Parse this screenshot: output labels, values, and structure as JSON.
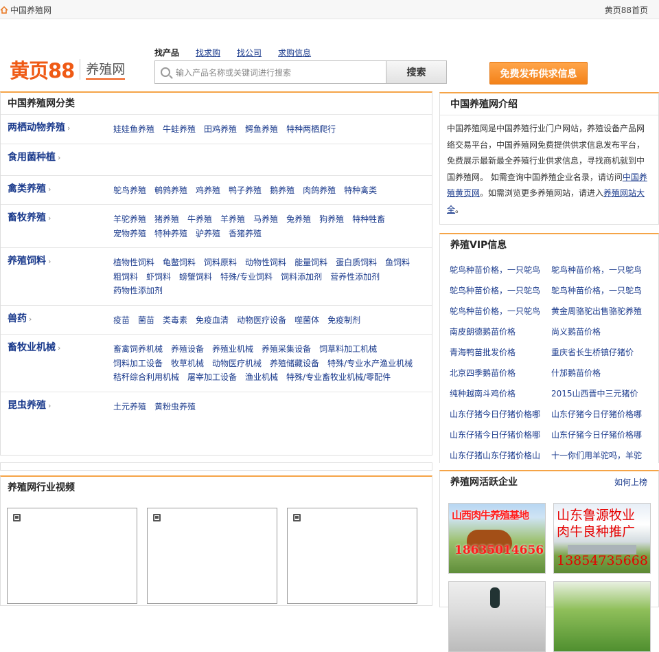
{
  "topbar": {
    "home_label": "中国养殖网",
    "right_link": "黄页88首页"
  },
  "logo": {
    "brand": "黄页88",
    "subbrand": "养殖网"
  },
  "search": {
    "tabs": [
      "找产品",
      "找求购",
      "找公司",
      "求购信息"
    ],
    "placeholder": "输入产品名称或关键词进行搜索",
    "button": "搜索"
  },
  "publish_button": "免费发布供求信息",
  "categories_panel": {
    "title": "中国养殖网分类",
    "categories": [
      {
        "name": "两栖动物养殖",
        "items": [
          "娃娃鱼养殖",
          "牛蛙养殖",
          "田鸡养殖",
          "鳄鱼养殖",
          "特种两栖爬行"
        ]
      },
      {
        "name": "食用菌种植",
        "items": []
      },
      {
        "name": "禽类养殖",
        "items": [
          "鸵鸟养殖",
          "鹌鹑养殖",
          "鸡养殖",
          "鸭子养殖",
          "鹅养殖",
          "肉鸽养殖",
          "特种禽类"
        ]
      },
      {
        "name": "畜牧养殖",
        "items": [
          "羊驼养殖",
          "猪养殖",
          "牛养殖",
          "羊养殖",
          "马养殖",
          "兔养殖",
          "狗养殖",
          "特种牲畜",
          "宠物养殖",
          "特种养殖",
          "驴养殖",
          "香猪养殖"
        ]
      },
      {
        "name": "养殖饲料",
        "items": [
          "植物性饲料",
          "龟鳖饲料",
          "饲料原料",
          "动物性饲料",
          "能量饲料",
          "蛋白质饲料",
          "鱼饲料",
          "粗饲料",
          "虾饲料",
          "螃蟹饲料",
          "特殊/专业饲料",
          "饲料添加剂",
          "营养性添加剂",
          "药物性添加剂"
        ]
      },
      {
        "name": "兽药",
        "items": [
          "疫苗",
          "菌苗",
          "类毒素",
          "免疫血清",
          "动物医疗设备",
          "噬菌体",
          "免疫制剂"
        ]
      },
      {
        "name": "畜牧业机械",
        "items": [
          "畜禽饲养机械",
          "养殖设备",
          "养殖业机械",
          "养殖采集设备",
          "饲草料加工机械",
          "饲料加工设备",
          "牧草机械",
          "动物医疗机械",
          "养殖储藏设备",
          "特殊/专业水产渔业机械",
          "秸秆综合利用机械",
          "屠宰加工设备",
          "渔业机械",
          "特殊/专业畜牧业机械/零配件"
        ]
      },
      {
        "name": "昆虫养殖",
        "items": [
          "土元养殖",
          "黄粉虫养殖"
        ]
      }
    ]
  },
  "video_panel": {
    "title": "养殖网行业视频"
  },
  "intro_panel": {
    "title": "中国养殖网介绍",
    "text1": "中国养殖网是中国养殖行业门户网站，养殖设备产品网络交易平台，中国养殖网免费提供供求信息发布平台，免费展示最新最全养殖行业供求信息，寻找商机就到中国养殖网。 如需查询中国养殖企业名录，请访问",
    "link1": "中国养殖黄页网",
    "text2": "。如需浏览更多养殖网站，请进入",
    "link2": "养殖网站大全",
    "text3": "。"
  },
  "vip_panel": {
    "title": "养殖VIP信息",
    "items": [
      "鸵鸟种苗价格，一只鸵鸟",
      "鸵鸟种苗价格，一只鸵鸟",
      "鸵鸟种苗价格，一只鸵鸟",
      "鸵鸟种苗价格，一只鸵鸟",
      "鸵鸟种苗价格，一只鸵鸟",
      "黄金周骆驼出售骆驼养殖",
      "南皮朗德鹅苗价格",
      "尚义鹅苗价格",
      "青海鸭苗批发价格",
      "重庆省长生桥镇仔猪价",
      "北京四季鹅苗价格",
      "什邡鹅苗价格",
      "纯种越南斗鸡价格",
      "2015山西晋中三元猪价",
      "山东仔猪今日仔猪价格哪",
      "山东仔猪今日仔猪价格哪",
      "山东仔猪今日仔猪价格哪",
      "山东仔猪今日仔猪价格哪",
      "山东仔猪山东仔猪价格山",
      "十一你们用羊驼吗，羊驼"
    ]
  },
  "active_panel": {
    "title": "养殖网活跃企业",
    "more": "如何上榜",
    "ad1": {
      "text": "山西肉牛养殖基地",
      "phone": "18635014656"
    },
    "ad2": {
      "line1": "山东鲁源牧业",
      "line2": "肉牛良种推广",
      "phone": "13854735668"
    }
  }
}
